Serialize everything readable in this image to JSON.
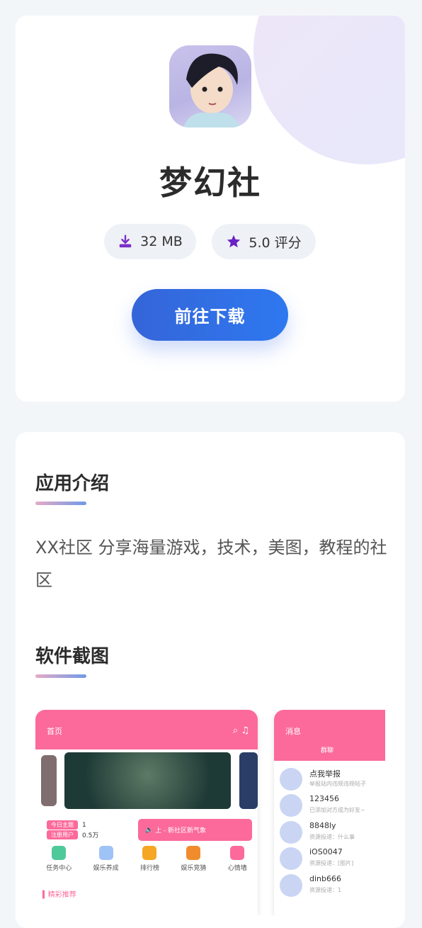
{
  "app": {
    "name": "梦幻社",
    "size": "32 MB",
    "rating": "5.0 评分",
    "download_label": "前往下载"
  },
  "intro": {
    "title": "应用介绍",
    "text": "XX社区 分享海量游戏，技术，美图，教程的社区"
  },
  "screenshots": {
    "title": "软件截图",
    "phone1": {
      "header": "首页",
      "stats": [
        {
          "tag": "今日主题",
          "value": "1"
        },
        {
          "tag": "注册用户",
          "value": "0.5万"
        }
      ],
      "notice": "上 - 新社区新气象",
      "nav": [
        {
          "label": "任务中心",
          "color": "#4fc99a"
        },
        {
          "label": "娱乐养成",
          "color": "#9fc3f7"
        },
        {
          "label": "排行榜",
          "color": "#f5a623"
        },
        {
          "label": "娱乐竞猜",
          "color": "#f5a623"
        },
        {
          "label": "心情墙",
          "color": "#fb6a9a"
        }
      ],
      "recommend": "精彩推荐"
    },
    "phone2": {
      "header": "消息",
      "tab": "群聊",
      "messages": [
        {
          "name": "点我举报",
          "sub": "举报站内违规违规帖子"
        },
        {
          "name": "123456",
          "sub": "已添加对方成为好友~"
        },
        {
          "name": "8848ly",
          "sub": "资源投递：什么事"
        },
        {
          "name": "iOS0047",
          "sub": "资源投递：[图片]"
        },
        {
          "name": "dinb666",
          "sub": "资源投递：1"
        }
      ]
    }
  }
}
